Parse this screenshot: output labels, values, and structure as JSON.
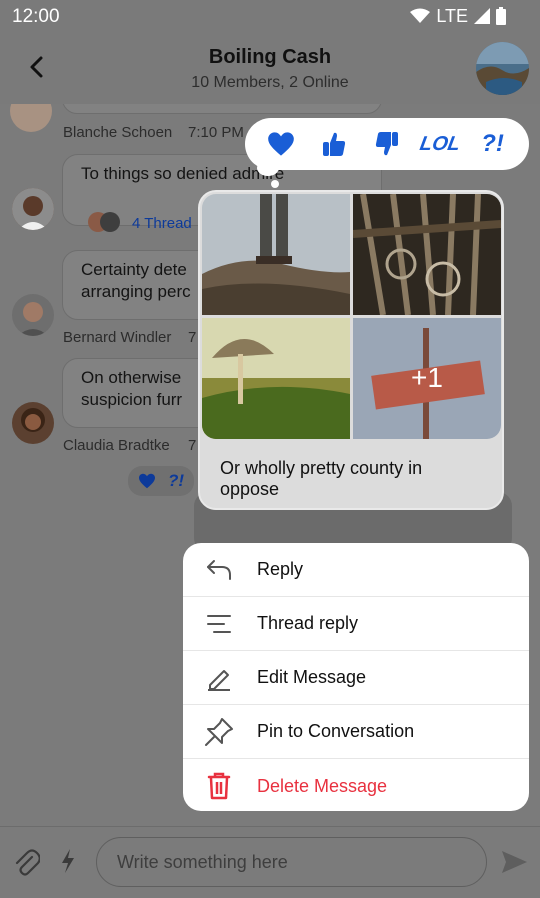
{
  "status_bar": {
    "time": "12:00",
    "network": "LTE"
  },
  "header": {
    "title": "Boiling Cash",
    "subtitle": "10 Members, 2 Online"
  },
  "chat": {
    "messages": [
      {
        "text": "To things so denied admire",
        "author": "Blanche Schoen",
        "time": "7:10 PM",
        "thread_label": "4 Thread"
      },
      {
        "text_line1": "Certainty dete",
        "text_line2": "arranging perc",
        "author": "Bernard Windler",
        "time": "7"
      },
      {
        "text_line1": "On otherwise",
        "text_line2": "suspicion furr",
        "author": "Claudia Bradtke",
        "time": "7"
      }
    ],
    "small_reactions": [
      "heart",
      "?!"
    ]
  },
  "reaction_bar": {
    "items": [
      {
        "name": "heart-reaction",
        "glyph": "heart"
      },
      {
        "name": "thumbs-up-reaction",
        "glyph": "thumbs-up"
      },
      {
        "name": "thumbs-down-reaction",
        "glyph": "thumbs-down"
      },
      {
        "name": "lol-reaction",
        "glyph": "LOL"
      },
      {
        "name": "wut-reaction",
        "glyph": "?!"
      }
    ]
  },
  "highlighted_message": {
    "text": "Or wholly pretty county in oppose",
    "extra_images": "+1"
  },
  "context_menu": {
    "items": [
      {
        "label": "Reply",
        "icon": "reply-icon"
      },
      {
        "label": "Thread reply",
        "icon": "thread-icon"
      },
      {
        "label": "Edit Message",
        "icon": "edit-icon"
      },
      {
        "label": "Pin to Conversation",
        "icon": "pin-icon"
      },
      {
        "label": "Delete Message",
        "icon": "trash-icon",
        "danger": true
      }
    ]
  },
  "composer": {
    "placeholder": "Write something here"
  },
  "colors": {
    "accent": "#1a5ed6",
    "danger": "#e8313f",
    "overlay": "#7b7b7b"
  }
}
